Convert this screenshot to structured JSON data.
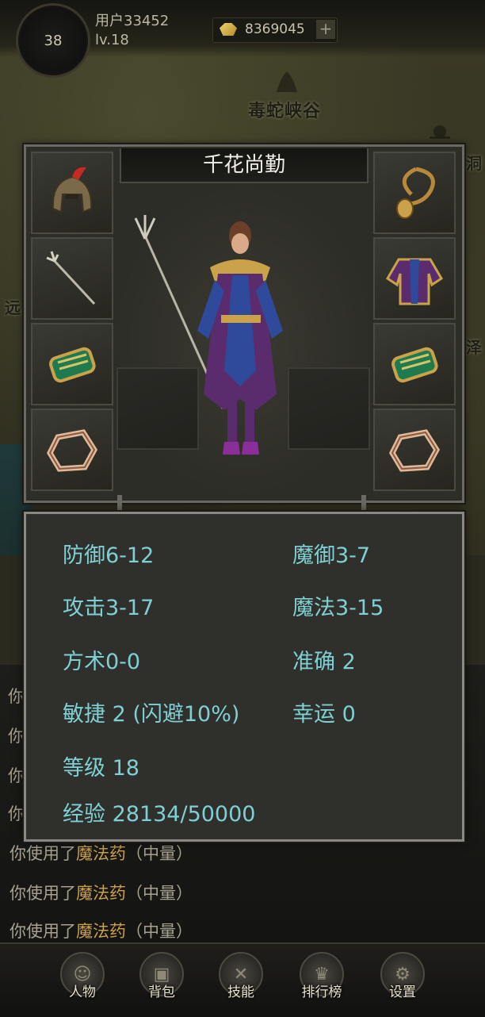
{
  "header": {
    "level": "38",
    "username": "用户33452",
    "user_level": "lv.18",
    "gold": "8369045",
    "add_label": "+"
  },
  "map": {
    "location_top": "毒蛇峡谷",
    "edge_left": "远",
    "edge_right": "泽",
    "edge_right_top": "洞"
  },
  "character": {
    "name": "千花尚勤",
    "equipment_left": [
      {
        "slot": "helmet",
        "icon": "helmet-icon"
      },
      {
        "slot": "weapon",
        "icon": "trident-icon"
      },
      {
        "slot": "bracer-left",
        "icon": "bracer-icon"
      },
      {
        "slot": "ring-left",
        "icon": "ring-icon"
      }
    ],
    "equipment_right": [
      {
        "slot": "necklace",
        "icon": "necklace-icon"
      },
      {
        "slot": "armor",
        "icon": "robe-icon"
      },
      {
        "slot": "bracer-right",
        "icon": "bracer-icon"
      },
      {
        "slot": "ring-right",
        "icon": "ring-icon"
      }
    ]
  },
  "stats": {
    "defense": "防御6-12",
    "magic_defense": "魔御3-7",
    "attack": "攻击3-17",
    "magic": "魔法3-15",
    "taoism": "方术0-0",
    "accuracy": "准确 2",
    "agility": "敏捷 2 (闪避10%)",
    "luck": "幸运 0",
    "level": "等级 18",
    "experience": "经验 28134/50000"
  },
  "chat": {
    "partial_lines": [
      "你",
      "你",
      "你",
      "你"
    ],
    "lines": [
      {
        "prefix": "你使用了",
        "item": "魔法药",
        "suffix": "（中量）"
      },
      {
        "prefix": "你使用了",
        "item": "魔法药",
        "suffix": "（中量）"
      },
      {
        "prefix": "你使用了",
        "item": "魔法药",
        "suffix": "（中量）"
      }
    ]
  },
  "nav": [
    {
      "label": "人物",
      "icon": "character-icon"
    },
    {
      "label": "背包",
      "icon": "backpack-icon"
    },
    {
      "label": "技能",
      "icon": "skills-icon"
    },
    {
      "label": "排行榜",
      "icon": "leaderboard-icon"
    },
    {
      "label": "设置",
      "icon": "settings-icon"
    }
  ],
  "colors": {
    "stat_text": "#7fd0d4",
    "item_highlight": "#c9a04c",
    "panel_border": "#8a8880"
  }
}
